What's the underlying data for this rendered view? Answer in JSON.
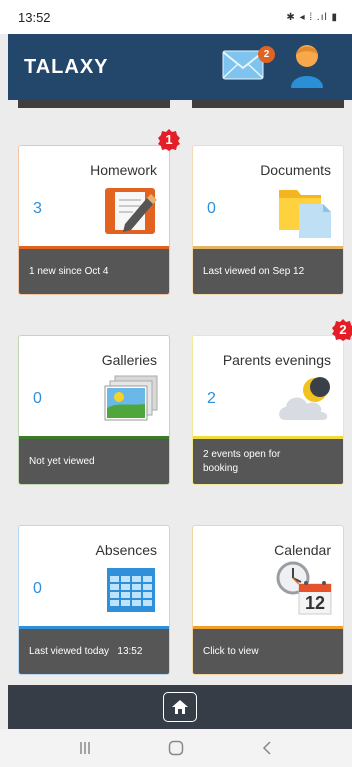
{
  "status_bar": {
    "time": "13:52",
    "icons": "✱ ◂ ⁞ .ıl ▮"
  },
  "header": {
    "logo": "TALAXY",
    "mail_badge": "2"
  },
  "tiles": [
    {
      "title": "Homework",
      "count": "3",
      "footer": "1 new since Oct 4",
      "accent": "#e2621f",
      "notification": "1"
    },
    {
      "title": "Documents",
      "count": "0",
      "footer": "Last viewed on Sep 12",
      "accent": "#e2b464"
    },
    {
      "title": "Galleries",
      "count": "0",
      "footer": "Not yet viewed",
      "accent": "#3d7a2a"
    },
    {
      "title": "Parents evenings",
      "count": "2",
      "footer": "2 events open for booking",
      "accent": "#f0dc3c",
      "notification": "2"
    },
    {
      "title": "Absences",
      "count": "0",
      "footer": "Last viewed today   13:52",
      "accent": "#2f8fd8"
    },
    {
      "title": "Calendar",
      "count": "",
      "footer": "Click to view",
      "accent": "#f0a028",
      "calendar_day": "12"
    }
  ],
  "colors": {
    "header": "#23476a",
    "tile_footer": "#565656",
    "count": "#2f8fd8",
    "badge": "#e2621f",
    "notification": "#e41e26"
  },
  "icons": [
    "mail-icon",
    "profile-icon",
    "homework-icon",
    "documents-icon",
    "galleries-icon",
    "weather-icon",
    "absences-icon",
    "calendar-icon",
    "home-icon"
  ]
}
